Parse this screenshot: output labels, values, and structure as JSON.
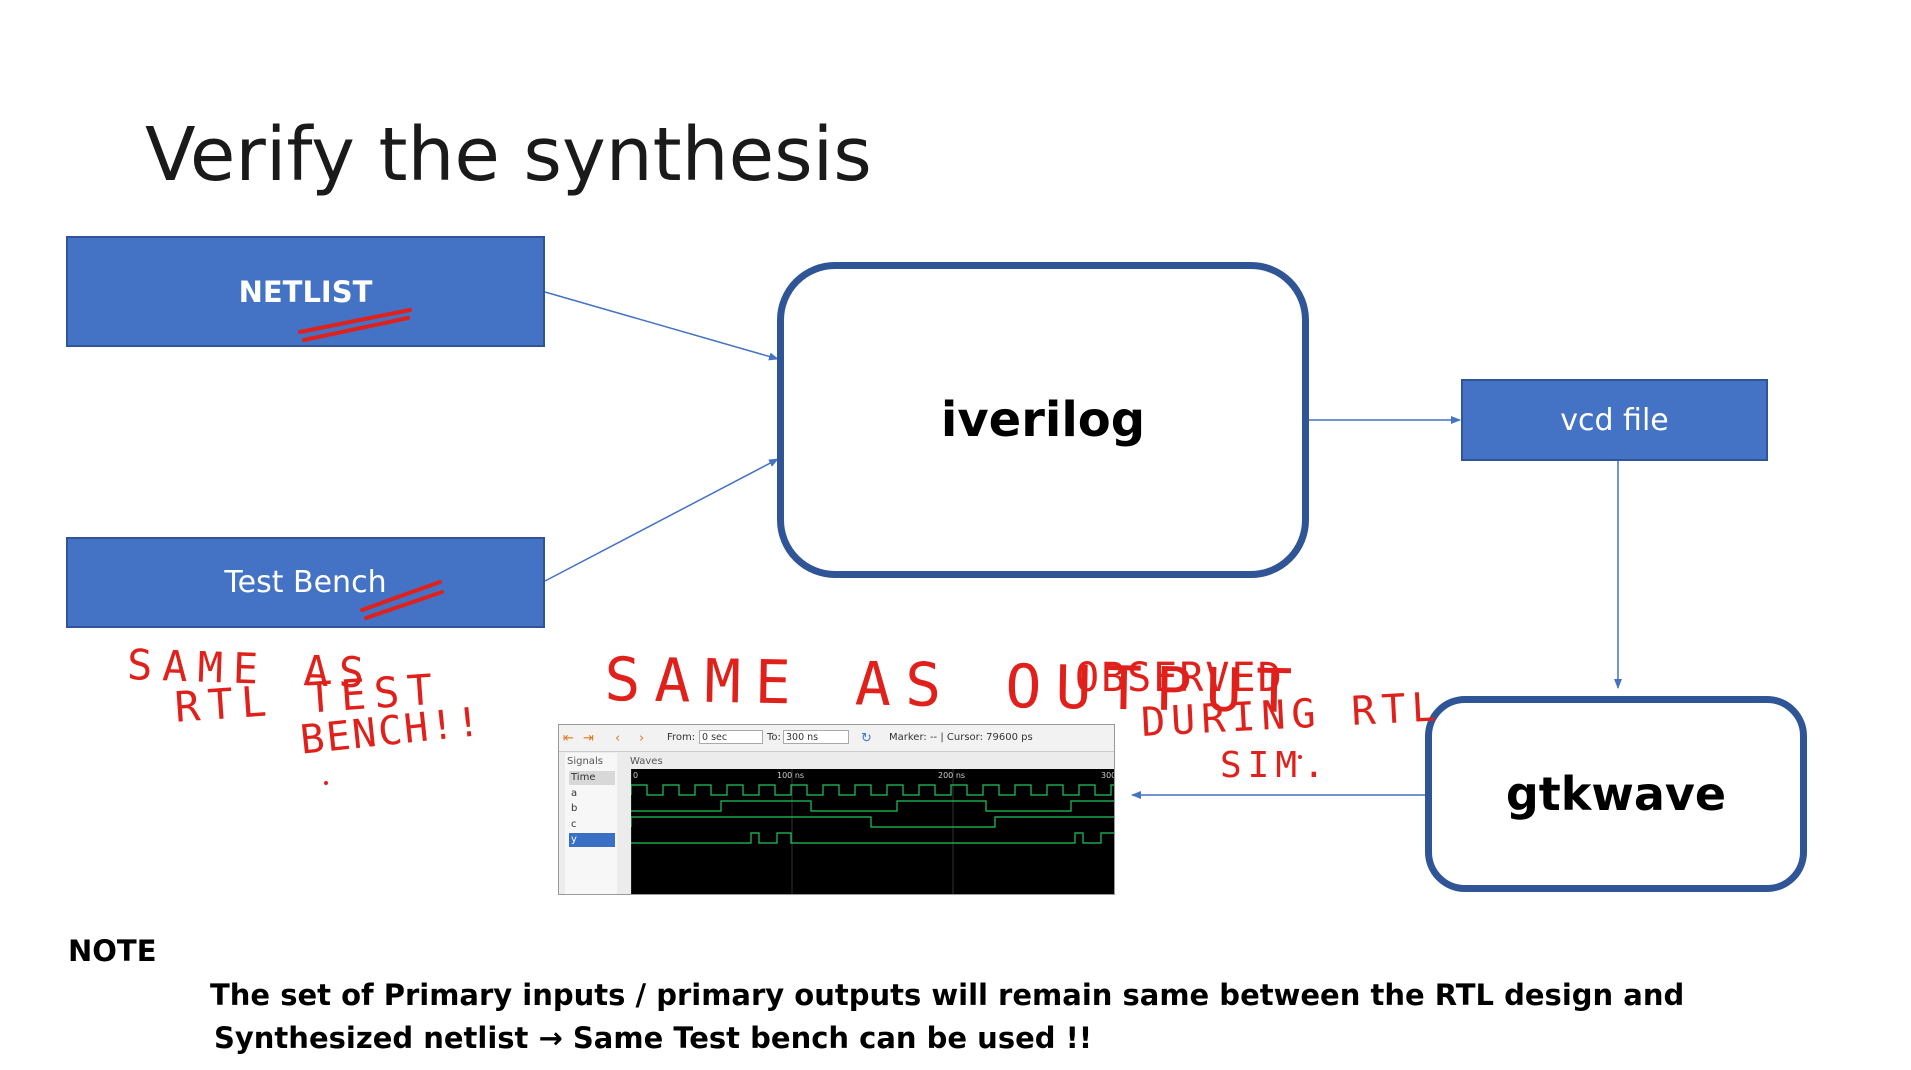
{
  "slide": {
    "title": "Verify the synthesis"
  },
  "diagram": {
    "netlist_label": "NETLIST",
    "testbench_label": "Test Bench",
    "iverilog_label": "iverilog",
    "vcd_label": "vcd file",
    "gtkwave_label": "gtkwave",
    "colors": {
      "box_fill": "#4472c4",
      "box_border": "#2f5597",
      "arrow": "#4472c4",
      "annotation": "#e0201b"
    }
  },
  "handwriting": {
    "tb_note_line1": "SAME AS",
    "tb_note_line2": "RTL TEST",
    "tb_note_line3": "BENCH!!",
    "output_note_line1": "SAME AS OUTPUT",
    "output_note_line2": "OBSERVED",
    "output_note_line3": "DURING RTL",
    "output_note_line4": "SIM."
  },
  "gtkwave_screenshot": {
    "from_label": "From:",
    "from_value": "0 sec",
    "to_label": "To:",
    "to_value": "300 ns",
    "marker_text": "Marker: -- | Cursor: 79600 ps",
    "signals_header": "Signals",
    "waves_header": "Waves",
    "signals": [
      "Time",
      "a",
      "b",
      "c",
      "y"
    ],
    "time_ticks": [
      "0",
      "100 ns",
      "200 ns",
      "300"
    ]
  },
  "note": {
    "heading": "NOTE",
    "line1": "The set of Primary inputs / primary outputs will remain same between the RTL design and",
    "line2": "Synthesized netlist  → Same Test bench can be used !!"
  }
}
